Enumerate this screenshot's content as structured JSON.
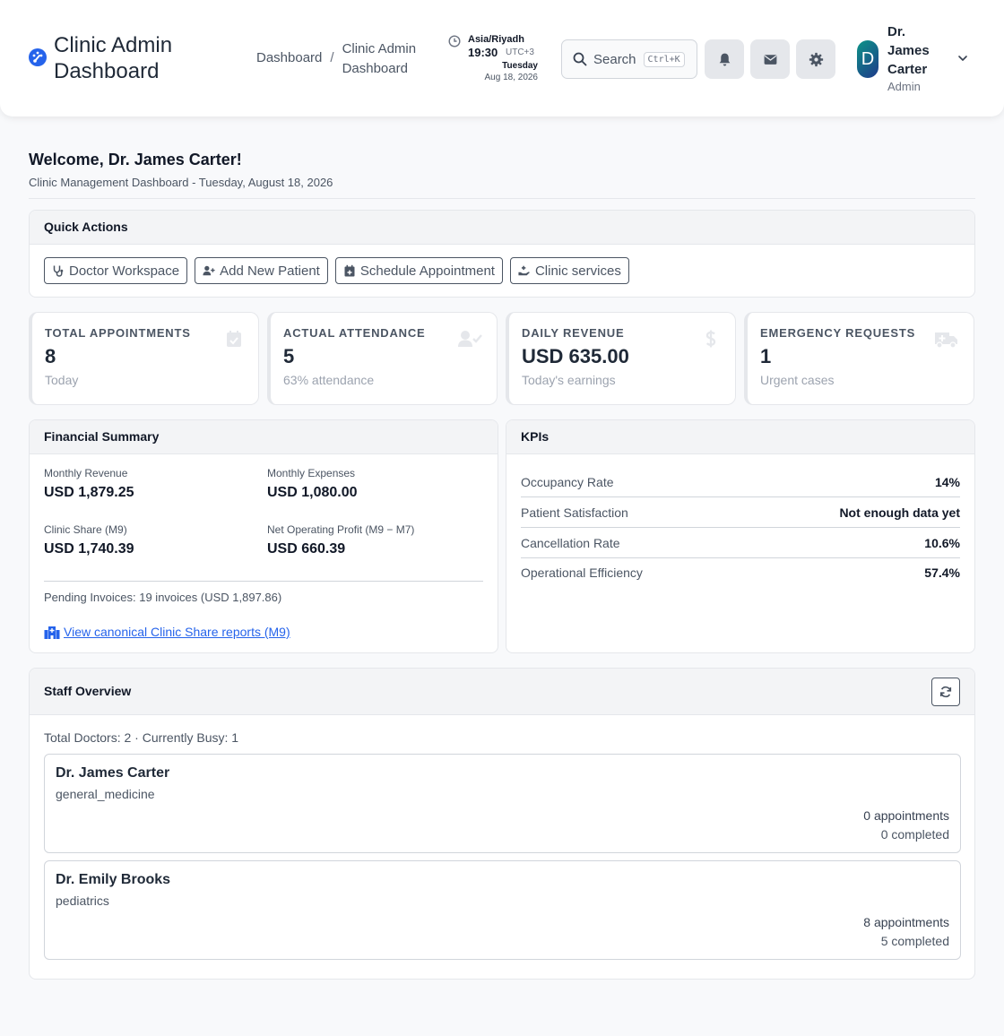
{
  "header": {
    "brand_title": "Clinic Admin Dashboard",
    "breadcrumb": [
      "Dashboard",
      "Clinic Admin Dashboard"
    ],
    "breadcrumb_sep": "/",
    "clock": {
      "timezone": "Asia/Riyadh",
      "time": "19:30",
      "utc": "UTC+3",
      "day": "Tuesday",
      "date": "Aug 18, 2026"
    },
    "search_label": "Search",
    "search_shortcut": "Ctrl+K",
    "user": {
      "initial": "D",
      "name": "Dr. James Carter",
      "role": "Admin"
    }
  },
  "welcome": {
    "title": "Welcome, Dr. James Carter!",
    "subtitle": "Clinic Management Dashboard - Tuesday, August 18, 2026"
  },
  "quick_actions": {
    "title": "Quick Actions",
    "buttons": [
      {
        "label": "Doctor Workspace",
        "icon": "stethoscope-icon"
      },
      {
        "label": "Add New Patient",
        "icon": "user-plus-icon"
      },
      {
        "label": "Schedule Appointment",
        "icon": "calendar-plus-icon"
      },
      {
        "label": "Clinic services",
        "icon": "hand-holding-medical-icon"
      }
    ]
  },
  "stats": [
    {
      "label": "TOTAL APPOINTMENTS",
      "value": "8",
      "note": "Today",
      "icon": "calendar-check-icon"
    },
    {
      "label": "ACTUAL ATTENDANCE",
      "value": "5",
      "note": "63% attendance",
      "icon": "user-check-icon"
    },
    {
      "label": "DAILY REVENUE",
      "value": "USD 635.00",
      "note": "Today's earnings",
      "icon": "dollar-icon"
    },
    {
      "label": "EMERGENCY REQUESTS",
      "value": "1",
      "note": "Urgent cases",
      "icon": "ambulance-icon"
    }
  ],
  "financial": {
    "title": "Financial Summary",
    "items": [
      {
        "label": "Monthly Revenue",
        "value": "USD 1,879.25"
      },
      {
        "label": "Monthly Expenses",
        "value": "USD 1,080.00"
      },
      {
        "label": "Clinic Share (M9)",
        "value": "USD 1,740.39"
      },
      {
        "label": "Net Operating Profit (M9 − M7)",
        "value": "USD 660.39"
      }
    ],
    "pending": "Pending Invoices: 19 invoices (USD 1,897.86)",
    "link": "View canonical Clinic Share reports (M9)"
  },
  "kpis": {
    "title": "KPIs",
    "rows": [
      {
        "name": "Occupancy Rate",
        "value": "14%"
      },
      {
        "name": "Patient Satisfaction",
        "value": "Not enough data yet"
      },
      {
        "name": "Cancellation Rate",
        "value": "10.6%"
      },
      {
        "name": "Operational Efficiency",
        "value": "57.4%"
      }
    ]
  },
  "staff": {
    "title": "Staff Overview",
    "summary": "Total Doctors: 2 · Currently Busy: 1",
    "doctors": [
      {
        "name": "Dr. James Carter",
        "specialty": "general_medicine",
        "appointments": "0 appointments",
        "completed": "0 completed"
      },
      {
        "name": "Dr. Emily Brooks",
        "specialty": "pediatrics",
        "appointments": "8 appointments",
        "completed": "5 completed"
      }
    ]
  },
  "colors": {
    "accent": "#2563eb",
    "avatar": "#0d9488",
    "panel_head": "#f3f4f6"
  }
}
